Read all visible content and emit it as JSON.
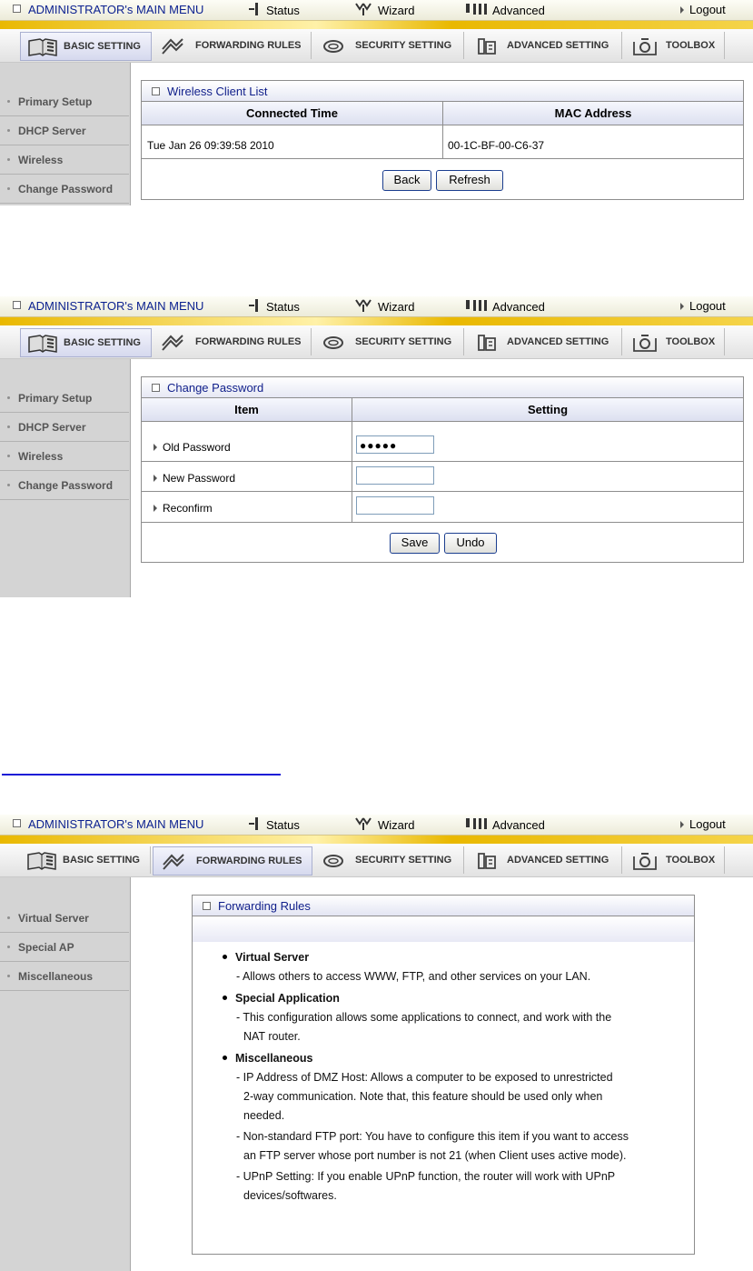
{
  "header": {
    "admin_title": "ADMINISTRATOR's MAIN MENU",
    "status": "Status",
    "wizard": "Wizard",
    "advanced": "Advanced",
    "logout": "Logout"
  },
  "tabs": {
    "basic": "BASIC SETTING",
    "forwarding": "FORWARDING RULES",
    "security": "SECURITY SETTING",
    "advanced": "ADVANCED SETTING",
    "toolbox": "TOOLBOX"
  },
  "basic_sidebar": {
    "primary_setup": "Primary Setup",
    "dhcp_server": "DHCP Server",
    "wireless": "Wireless",
    "change_password": "Change Password"
  },
  "forwarding_sidebar": {
    "virtual_server": "Virtual Server",
    "special_ap": "Special AP",
    "miscellaneous": "Miscellaneous"
  },
  "wireless_client_list": {
    "title": "Wireless Client List",
    "col_time": "Connected Time",
    "col_mac": "MAC Address",
    "row_time": "Tue Jan 26 09:39:58 2010",
    "row_mac": "00-1C-BF-00-C6-37",
    "back": "Back",
    "refresh": "Refresh"
  },
  "change_password": {
    "title": "Change Password",
    "col_item": "Item",
    "col_setting": "Setting",
    "old_password_label": "Old Password",
    "old_password_value": "●●●●●",
    "new_password_label": "New Password",
    "reconfirm_label": "Reconfirm",
    "save": "Save",
    "undo": "Undo"
  },
  "forwarding_rules": {
    "title": "Forwarding Rules",
    "vs_title": "Virtual Server",
    "vs_desc": "- Allows others to access WWW, FTP, and other services on your LAN.",
    "sa_title": "Special Application",
    "sa_desc1": "- This configuration allows some applications to connect, and work with the",
    "sa_desc2": "NAT router.",
    "misc_title": "Miscellaneous",
    "misc_dmz1": "- IP Address of DMZ Host: Allows a computer to be exposed to unrestricted",
    "misc_dmz2": "2-way communication. Note that, this feature should be used only when",
    "misc_dmz3": "needed.",
    "misc_ftp1": "- Non-standard FTP port: You have to configure this item if you want to access",
    "misc_ftp2": "an FTP server whose port number is not 21 (when Client uses active mode).",
    "misc_upnp1": "- UPnP Setting: If you enable UPnP function, the router will work with UPnP",
    "misc_upnp2": "devices/softwares."
  }
}
